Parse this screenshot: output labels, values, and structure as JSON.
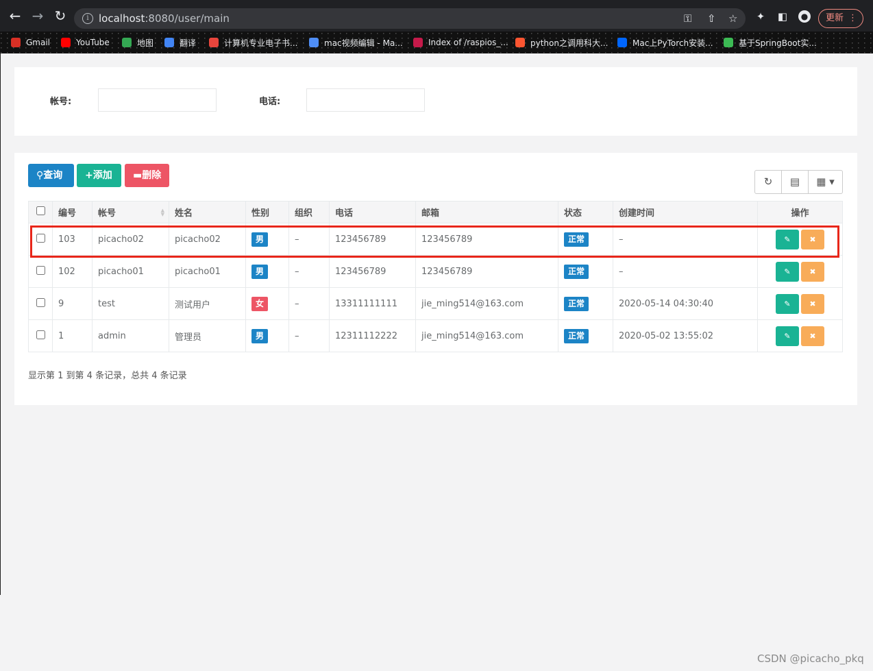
{
  "browser": {
    "url_host": "localhost",
    "url_path": ":8080/user/main",
    "update_label": "更新",
    "bookmarks": [
      {
        "label": "Gmail",
        "icon": "gmail-icon",
        "color": "#d93025"
      },
      {
        "label": "YouTube",
        "icon": "youtube-icon",
        "color": "#ff0000"
      },
      {
        "label": "地图",
        "icon": "maps-icon",
        "color": "#34a853"
      },
      {
        "label": "翻译",
        "icon": "translate-icon",
        "color": "#4285f4"
      },
      {
        "label": "计算机专业电子书...",
        "icon": "ebook-icon",
        "color": "#e8453c"
      },
      {
        "label": "mac视频编辑 - Ma...",
        "icon": "mac-video-icon",
        "color": "#4f8ef7"
      },
      {
        "label": "Index of /raspios_...",
        "icon": "raspberry-icon",
        "color": "#c51a4a"
      },
      {
        "label": "python之调用科大...",
        "icon": "csdn-icon",
        "color": "#fc5531"
      },
      {
        "label": "Mac上PyTorch安装...",
        "icon": "zhihu-icon",
        "color": "#0066ff"
      },
      {
        "label": "基于SpringBoot实...",
        "icon": "leaf-icon",
        "color": "#3cba54"
      }
    ]
  },
  "search": {
    "account_label": "帐号:",
    "account_value": "",
    "phone_label": "电话:",
    "phone_value": ""
  },
  "toolbar": {
    "query_label": "查询",
    "add_label": "添加",
    "delete_label": "删除"
  },
  "table": {
    "columns": [
      "",
      "编号",
      "帐号",
      "姓名",
      "性别",
      "组织",
      "电话",
      "邮箱",
      "状态",
      "创建时间",
      "操作"
    ],
    "rows": [
      {
        "id": "103",
        "account": "picacho02",
        "name": "picacho02",
        "gender": "男",
        "org": "–",
        "phone": "123456789",
        "email": "123456789",
        "status": "正常",
        "created": "–"
      },
      {
        "id": "102",
        "account": "picacho01",
        "name": "picacho01",
        "gender": "男",
        "org": "–",
        "phone": "123456789",
        "email": "123456789",
        "status": "正常",
        "created": "–"
      },
      {
        "id": "9",
        "account": "test",
        "name": "测试用户",
        "gender": "女",
        "org": "–",
        "phone": "13311111111",
        "email": "jie_ming514@163.com",
        "status": "正常",
        "created": "2020-05-14 04:30:40"
      },
      {
        "id": "1",
        "account": "admin",
        "name": "管理员",
        "gender": "男",
        "org": "–",
        "phone": "12311112222",
        "email": "jie_ming514@163.com",
        "status": "正常",
        "created": "2020-05-02 13:55:02"
      }
    ]
  },
  "pagination_info": "显示第 1 到第 4 条记录，总共 4 条记录",
  "watermark": "CSDN @picacho_pkq",
  "colors": {
    "primary": "#1c84c6",
    "success": "#1ab394",
    "danger": "#ed5565",
    "warning": "#f8ac59",
    "highlight": "#e8261a"
  }
}
